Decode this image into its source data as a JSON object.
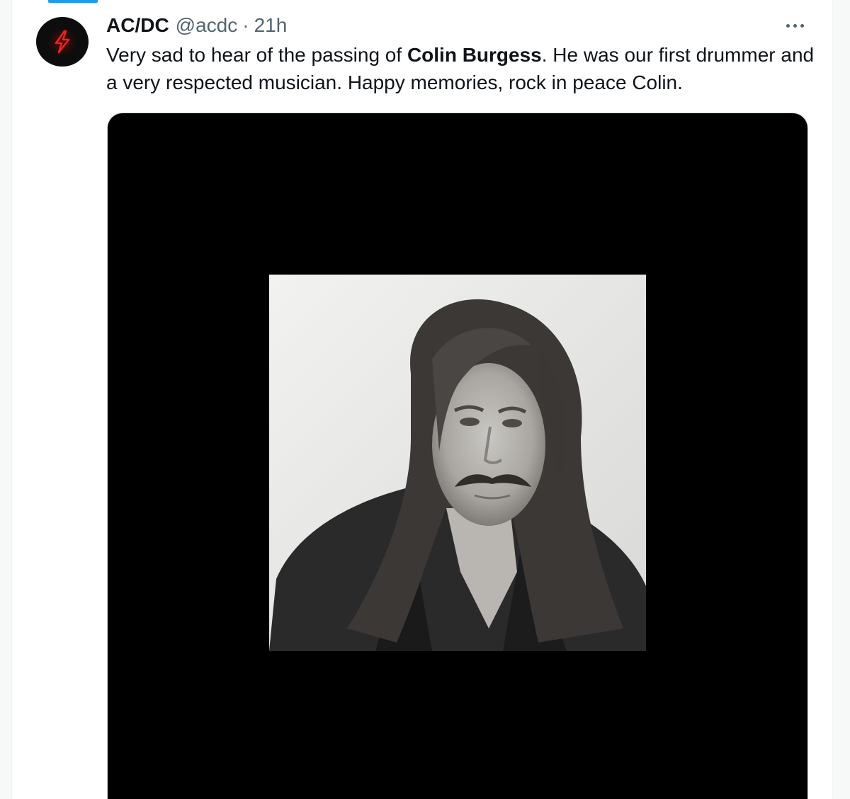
{
  "tweet": {
    "author_name": "AC/DC",
    "author_handle": "@acdc",
    "separator": "·",
    "timestamp": "21h",
    "text_before": "Very sad to hear of the passing of ",
    "text_bold": "Colin Burgess",
    "text_after": ". He was our first drummer and a very respected musician. Happy memories, rock in peace Colin."
  },
  "icons": {
    "avatar": "lightning-bolt-icon",
    "more": "more-options-icon"
  },
  "colors": {
    "accent": "#1d9bf0",
    "text_primary": "#0f1419",
    "text_secondary": "#536471",
    "avatar_bolt": "#e3261f"
  }
}
